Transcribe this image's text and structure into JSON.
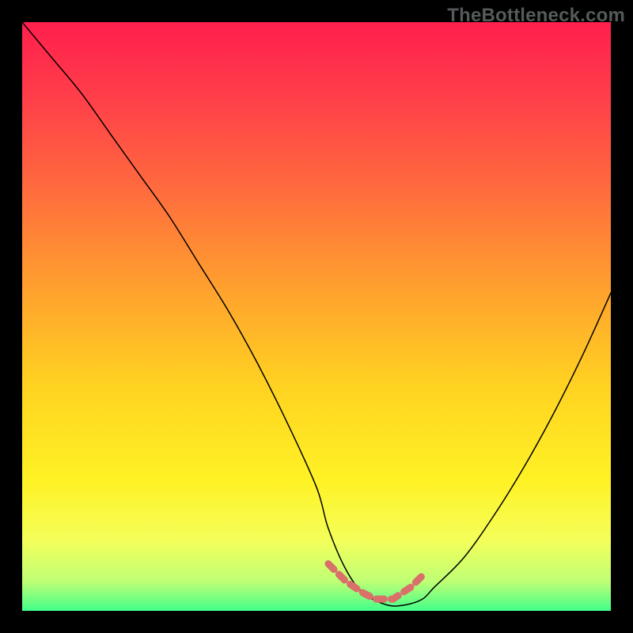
{
  "watermark": {
    "text": "TheBottleneck.com"
  },
  "colors": {
    "frame_bg": "#000000",
    "gradient_stops": [
      {
        "offset": "0%",
        "color": "#ff1f4d"
      },
      {
        "offset": "12%",
        "color": "#ff3c4a"
      },
      {
        "offset": "28%",
        "color": "#ff6a3e"
      },
      {
        "offset": "45%",
        "color": "#ffa02e"
      },
      {
        "offset": "62%",
        "color": "#ffd321"
      },
      {
        "offset": "78%",
        "color": "#fff225"
      },
      {
        "offset": "88%",
        "color": "#f4ff5a"
      },
      {
        "offset": "95%",
        "color": "#bfff75"
      },
      {
        "offset": "100%",
        "color": "#42ff8a"
      }
    ],
    "curve": "#000000",
    "marker": "#d9706a"
  },
  "chart_data": {
    "type": "line",
    "title": "",
    "xlabel": "",
    "ylabel": "",
    "xlim": [
      0,
      100
    ],
    "ylim": [
      0,
      100
    ],
    "grid": false,
    "legend_position": "none",
    "series": [
      {
        "name": "bottleneck-curve",
        "x": [
          0,
          5,
          10,
          15,
          20,
          25,
          30,
          35,
          40,
          45,
          50,
          52,
          55,
          58,
          62,
          65,
          68,
          70,
          75,
          80,
          85,
          90,
          95,
          100
        ],
        "values": [
          100,
          94,
          88,
          81,
          74,
          67,
          59,
          51,
          42,
          32,
          21,
          14,
          7,
          3,
          1,
          1,
          2,
          4,
          9,
          16,
          24,
          33,
          43,
          54
        ]
      }
    ],
    "annotations": [
      {
        "name": "bottom-valley-marker",
        "style": "dashed",
        "color": "#d9706a",
        "points_x": [
          52,
          55,
          58,
          60,
          63,
          66,
          68
        ],
        "points_y": [
          8,
          5,
          3,
          2,
          2,
          4,
          6
        ]
      }
    ]
  }
}
